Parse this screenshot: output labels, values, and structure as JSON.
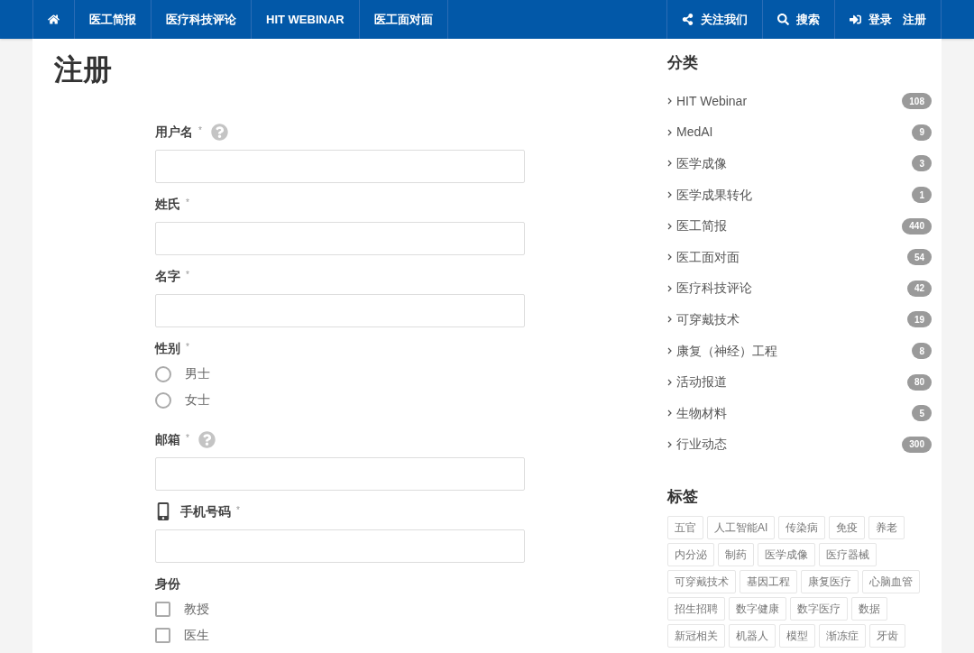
{
  "nav": {
    "left": [
      {
        "kind": "home"
      },
      {
        "label": "医工简报"
      },
      {
        "label": "医疗科技评论"
      },
      {
        "label": "HIT WEBINAR"
      },
      {
        "label": "医工面对面"
      }
    ],
    "right": [
      {
        "kind": "share",
        "label": "关注我们"
      },
      {
        "kind": "search",
        "label": "搜索"
      },
      {
        "kind": "signin",
        "label": "登录",
        "extra": "注册"
      }
    ]
  },
  "page_title": "注册",
  "form": {
    "fields": [
      {
        "kind": "text",
        "label": "用户名",
        "required_mark": "*",
        "help": true
      },
      {
        "kind": "text",
        "label": "姓氏",
        "required_mark": "*",
        "help": false
      },
      {
        "kind": "text",
        "label": "名字",
        "required_mark": "*",
        "help": false
      },
      {
        "kind": "radio",
        "label": "性别",
        "required_mark": "*",
        "options": [
          {
            "label": "男士",
            "selected": false
          },
          {
            "label": "女士",
            "selected": false
          }
        ]
      },
      {
        "kind": "text",
        "label": "邮箱",
        "required_mark": "*",
        "help": true
      },
      {
        "kind": "phone",
        "label": "手机号码",
        "required_mark": "*",
        "help": false
      },
      {
        "kind": "checkbox",
        "label": "身份",
        "options": [
          {
            "label": "教授",
            "checked": false
          },
          {
            "label": "医生",
            "checked": false
          }
        ]
      }
    ]
  },
  "sidebar": {
    "categories_title": "分类",
    "categories": [
      {
        "name": "HIT Webinar",
        "count": "108"
      },
      {
        "name": "MedAI",
        "count": "9"
      },
      {
        "name": "医学成像",
        "count": "3"
      },
      {
        "name": "医学成果转化",
        "count": "1"
      },
      {
        "name": "医工简报",
        "count": "440"
      },
      {
        "name": "医工面对面",
        "count": "54"
      },
      {
        "name": "医疗科技评论",
        "count": "42"
      },
      {
        "name": "可穿戴技术",
        "count": "19"
      },
      {
        "name": "康复（神经）工程",
        "count": "8"
      },
      {
        "name": "活动报道",
        "count": "80"
      },
      {
        "name": "生物材料",
        "count": "5"
      },
      {
        "name": "行业动态",
        "count": "300"
      }
    ],
    "tags_title": "标签",
    "tags": [
      "五官",
      "人工智能AI",
      "传染病",
      "免疫",
      "养老",
      "内分泌",
      "制药",
      "医学成像",
      "医疗器械",
      "可穿戴技术",
      "基因工程",
      "康复医疗",
      "心脑血管",
      "招生招聘",
      "数字健康",
      "数字医疗",
      "数据",
      "新冠相关",
      "机器人",
      "模型",
      "渐冻症",
      "牙齿"
    ]
  }
}
